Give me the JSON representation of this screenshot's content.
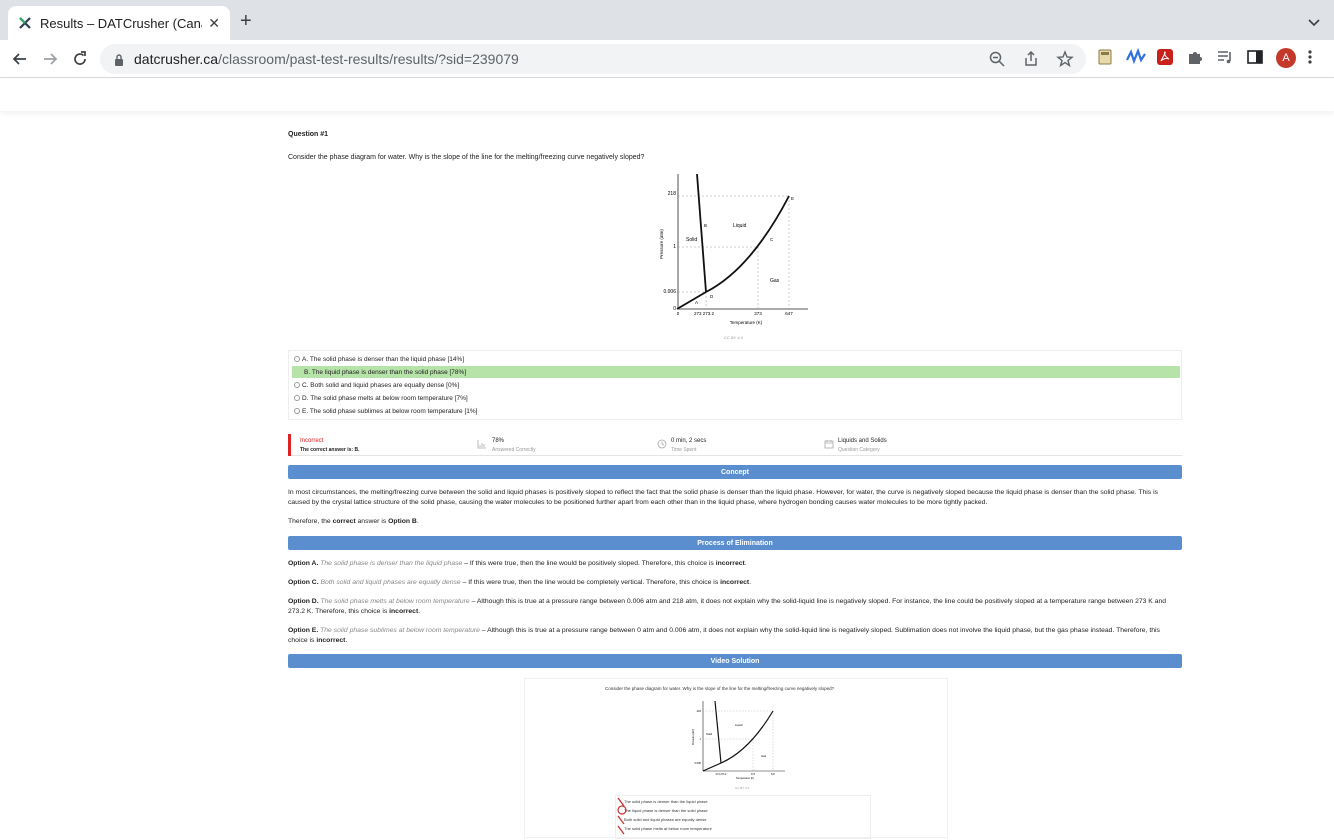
{
  "browser": {
    "tab_title": "Results – DATCrusher (Canadian",
    "url_host": "datcrusher.ca",
    "url_path": "/classroom/past-test-results/results/?sid=239079",
    "avatar_letter": "A"
  },
  "question": {
    "number_label": "Question #1",
    "text": "Consider the phase diagram for water. Why is the slope of the line for the melting/freezing curve negatively sloped?"
  },
  "diagram": {
    "ylabel": "Pressure (atm)",
    "xlabel": "Temperature (K)",
    "caption": "CC BY 4.0",
    "y_ticks": [
      "218",
      "1",
      "0.006",
      "0"
    ],
    "x_ticks": [
      "0",
      "273 273.2",
      "373",
      "647"
    ],
    "regions": [
      "Solid",
      "Liquid",
      "Gas"
    ],
    "points": [
      "A",
      "B",
      "C",
      "D",
      "E"
    ]
  },
  "options": [
    {
      "label": "A. The solid phase is denser than the liquid phase [14%]",
      "selected": false
    },
    {
      "label": "B. The liquid phase is denser than the solid phase [78%]",
      "selected": true
    },
    {
      "label": "C. Both solid and liquid phases are equally dense [0%]",
      "selected": false
    },
    {
      "label": "D. The solid phase melts at below room temperature [7%]",
      "selected": false
    },
    {
      "label": "E. The solid phase sublimes at below room temperature [1%]",
      "selected": false
    }
  ],
  "stats": {
    "result": "Incorrect",
    "correct_answer": "The correct answer is: B.",
    "percent": "78%",
    "percent_label": "Answered Correctly",
    "time": "0 min, 2 secs",
    "time_label": "Time Spent",
    "category": "Liquids and Solids",
    "category_label": "Question Category"
  },
  "concept": {
    "heading": "Concept",
    "text": "In most circumstances, the melting/freezing curve between the solid and liquid phases is positively sloped to reflect the fact that the solid phase is denser than the liquid phase. However, for water, the curve is negatively sloped because the liquid phase is denser than the solid phase. This is caused by the crystal lattice structure of the solid phase, causing the water molecules to be positioned further apart from each other than in the liquid phase, where hydrogen bonding causes water molecules to be more tightly packed.",
    "answer_prefix": "Therefore, the",
    "answer_bold": "correct",
    "answer_mid": "answer is",
    "answer_option": "Option B",
    "answer_end": "."
  },
  "elimination": {
    "heading": "Process of Elimination",
    "items": [
      {
        "opt": "Option A.",
        "desc": "The solid phase is denser than the liquid phase",
        "text": " – If this were true, then the line would be positively sloped. Therefore, this choice is ",
        "verdict": "incorrect",
        "end": "."
      },
      {
        "opt": "Option C.",
        "desc": "Both solid and liquid phases are equally dense",
        "text": " – If this were true, then the line would be completely vertical. Therefore, this choice is ",
        "verdict": "incorrect",
        "end": "."
      },
      {
        "opt": "Option D.",
        "desc": "The solid phase melts at below room temperature",
        "text": " – Although this is true at a pressure range between 0.006 atm and 218 atm, it does not explain why the solid-liquid line is negatively sloped. For instance, the line could be positively sloped at a temperature range between 273 K and 273.2 K. Therefore, this choice is ",
        "verdict": "incorrect",
        "end": "."
      },
      {
        "opt": "Option E.",
        "desc": "The solid phase sublimes at below room temperature",
        "text": " – Although this is true at a pressure range between 0 atm and 0.006 atm, it does not explain why the solid-liquid line is negatively sloped. Sublimation does not involve the liquid phase, but the gas phase instead. Therefore, this choice is ",
        "verdict": "incorrect",
        "end": "."
      }
    ]
  },
  "video": {
    "heading": "Video Solution",
    "question": "Consider the phase diagram for water. Why is the slope of the line for the melting/freezing curve negatively sloped?",
    "options": [
      "The solid phase is denser than the liquid phase",
      "The liquid phase is denser than the solid phase",
      "Both solid and liquid phases are equally dense",
      "The solid phase melts at below room temperature"
    ],
    "caption": "CC BY 4.0",
    "regions": [
      "Solid",
      "Liquid",
      "Gas"
    ],
    "y_ticks": [
      "218",
      "1",
      "0.006"
    ],
    "x_ticks": [
      "273 273.2",
      "373",
      "647"
    ],
    "xlabel": "Temperature (K)",
    "ylabel": "Pressure (atm)"
  },
  "colors": {
    "banner": "#5b8ecf",
    "selected": "#b6e3a8",
    "incorrect": "#dd2222"
  }
}
